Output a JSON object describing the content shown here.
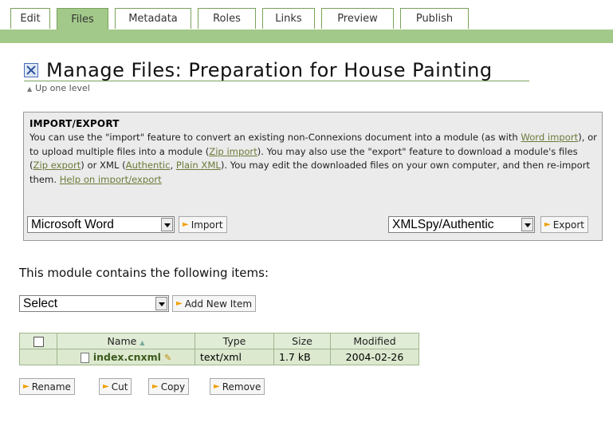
{
  "tabs": [
    "Edit",
    "Files",
    "Metadata",
    "Roles",
    "Links",
    "Preview",
    "Publish"
  ],
  "active_tab": "Files",
  "page_title": "Manage Files: Preparation for House Painting",
  "up_one_level": "Up one level",
  "import_export": {
    "heading": "IMPORT/EXPORT",
    "text_1": "You can use the \"import\" feature to convert an existing non-Connexions document into a module (as with ",
    "link_word_import": "Word import",
    "text_2": "), or to upload multiple files into a module (",
    "link_zip_import": "Zip import",
    "text_3": "). You may also use the \"export\" feature to download a module's files (",
    "link_zip_export": "Zip export",
    "text_4": ") or XML (",
    "link_authentic": "Authentic",
    "text_5": ", ",
    "link_plain_xml": "Plain XML",
    "text_6": "). You may edit the downloaded files on your own computer, and then re-import them. ",
    "link_help": "Help on import/export",
    "import_select": "Microsoft Word",
    "import_button": "Import",
    "export_select": "XMLSpy/Authentic",
    "export_button": "Export"
  },
  "contains_text": "This module contains the following items:",
  "add_select": "Select",
  "add_button": "Add New Item",
  "table": {
    "headers": [
      "Name",
      "Type",
      "Size",
      "Modified"
    ],
    "rows": [
      {
        "name": "index.cnxml",
        "type": "text/xml",
        "size": "1.7 kB",
        "modified": "2004-02-26"
      }
    ]
  },
  "actions": [
    "Rename",
    "Cut",
    "Copy",
    "Remove"
  ]
}
